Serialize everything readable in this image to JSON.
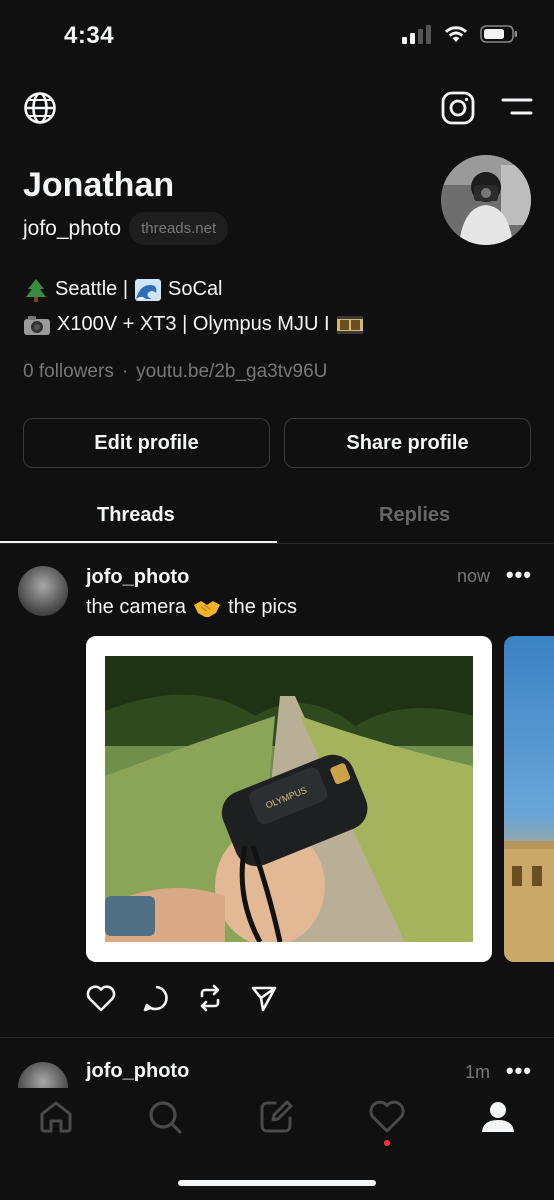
{
  "status_bar": {
    "time": "4:34"
  },
  "profile": {
    "name": "Jonathan",
    "handle": "jofo_photo",
    "domain_badge": "threads.net",
    "bio_line1_a": "Seattle |",
    "bio_line1_b": "SoCal",
    "bio_line2_a": "X100V + XT3 | Olympus MJU I",
    "followers": "0 followers",
    "separator": "·",
    "link": "youtu.be/2b_ga3tv96U"
  },
  "buttons": {
    "edit": "Edit profile",
    "share": "Share profile"
  },
  "tabs": [
    {
      "label": "Threads"
    },
    {
      "label": "Replies"
    }
  ],
  "posts": [
    {
      "user": "jofo_photo",
      "time": "now",
      "text_a": "the camera",
      "text_b": "the pics",
      "more": "•••"
    },
    {
      "user": "jofo_photo",
      "time": "1m",
      "more": "•••"
    }
  ],
  "icons": {
    "globe": "globe-icon",
    "instagram": "instagram-icon",
    "menu": "menu-icon",
    "like": "heart-icon",
    "comment": "comment-icon",
    "repost": "repost-icon",
    "share": "send-icon",
    "nav_home": "home-icon",
    "nav_search": "search-icon",
    "nav_compose": "compose-icon",
    "nav_activity": "heart-icon",
    "nav_profile": "profile-icon"
  },
  "colors": {
    "background": "#101010",
    "text": "#f3f5f7",
    "muted": "#777777",
    "notification": "#ff3040"
  }
}
